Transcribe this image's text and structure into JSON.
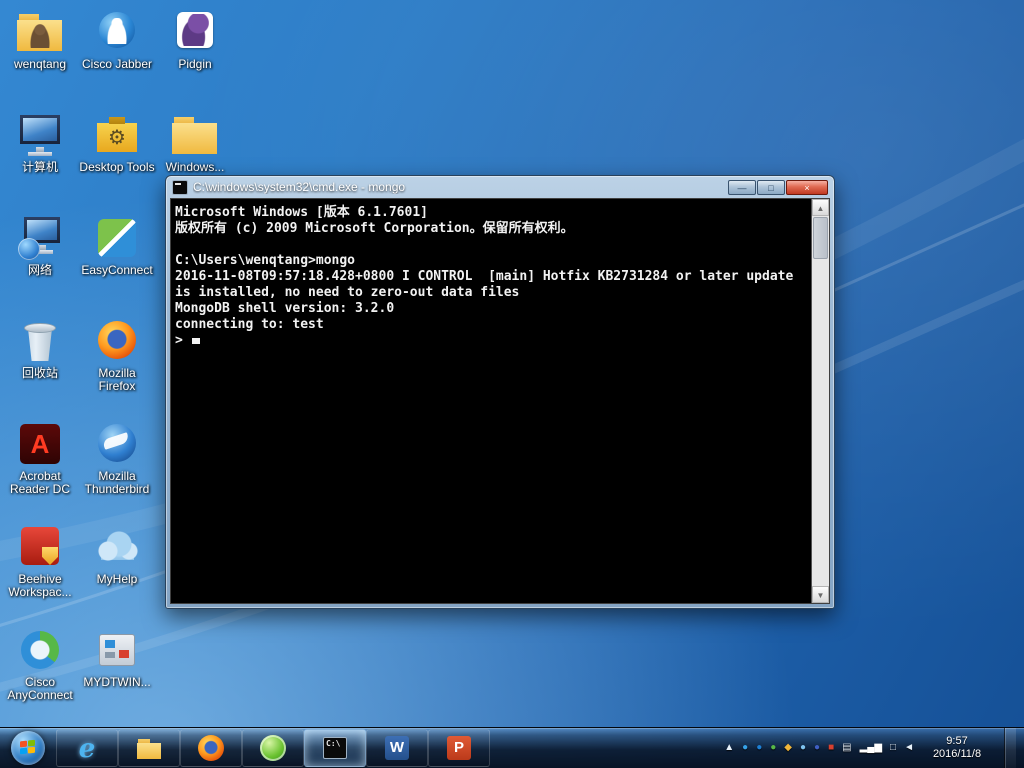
{
  "desktop": {
    "icons": [
      {
        "label": "wenqtang",
        "type": "user-folder",
        "col": 0,
        "row": 0
      },
      {
        "label": "计算机",
        "type": "computer",
        "col": 0,
        "row": 1
      },
      {
        "label": "网络",
        "type": "network",
        "col": 0,
        "row": 2
      },
      {
        "label": "回收站",
        "type": "recycle-bin",
        "col": 0,
        "row": 3
      },
      {
        "label": "Acrobat Reader DC",
        "type": "acrobat",
        "col": 0,
        "row": 4
      },
      {
        "label": "Beehive Workspac...",
        "type": "beehive",
        "col": 0,
        "row": 5
      },
      {
        "label": "Cisco AnyConnect",
        "type": "anyconnect",
        "col": 0,
        "row": 6
      },
      {
        "label": "Cisco Jabber",
        "type": "jabber",
        "col": 1,
        "row": 0
      },
      {
        "label": "Desktop Tools",
        "type": "toolbox",
        "col": 1,
        "row": 1
      },
      {
        "label": "EasyConnect",
        "type": "easyconnect",
        "col": 1,
        "row": 2
      },
      {
        "label": "Mozilla Firefox",
        "type": "firefox",
        "col": 1,
        "row": 3
      },
      {
        "label": "Mozilla Thunderbird",
        "type": "thunderbird",
        "col": 1,
        "row": 4
      },
      {
        "label": "MyHelp",
        "type": "myhelp",
        "col": 1,
        "row": 5
      },
      {
        "label": "MYDTWIN...",
        "type": "installer",
        "col": 1,
        "row": 6
      },
      {
        "label": "Pidgin",
        "type": "pidgin",
        "col": 2,
        "row": 0
      },
      {
        "label": "Windows...",
        "type": "folder",
        "col": 2,
        "row": 1
      }
    ]
  },
  "window": {
    "title": "C:\\windows\\system32\\cmd.exe - mongo",
    "controls": {
      "minimize": "—",
      "maximize": "□",
      "close": "×"
    },
    "scrollbar": {
      "up": "▲",
      "down": "▼"
    },
    "lines": [
      "Microsoft Windows [版本 6.1.7601]",
      "版权所有 (c) 2009 Microsoft Corporation。保留所有权利。",
      "",
      "C:\\Users\\wenqtang>mongo",
      "2016-11-08T09:57:18.428+0800 I CONTROL  [main] Hotfix KB2731284 or later update",
      "is installed, no need to zero-out data files",
      "MongoDB shell version: 3.2.0",
      "connecting to: test",
      "> "
    ]
  },
  "taskbar": {
    "buttons": [
      {
        "icon": "ie-icon",
        "active": false
      },
      {
        "icon": "explorer-icon",
        "active": false
      },
      {
        "icon": "firefox-icon",
        "active": false
      },
      {
        "icon": "browser-icon",
        "active": false
      },
      {
        "icon": "cmd-icon",
        "active": true
      },
      {
        "icon": "word-icon",
        "active": false
      },
      {
        "icon": "powerpoint-icon",
        "active": false
      }
    ],
    "tray": [
      {
        "name": "hidden-icons-chevron",
        "glyph": "▲",
        "color": "#e8f2fb"
      },
      {
        "name": "tray-blue-app-icon",
        "glyph": "●",
        "color": "#35a2e8"
      },
      {
        "name": "tray-jabber-icon",
        "glyph": "●",
        "color": "#1d7fd4"
      },
      {
        "name": "tray-green-app-icon",
        "glyph": "●",
        "color": "#57b847"
      },
      {
        "name": "tray-shield-icon",
        "glyph": "◆",
        "color": "#f0b63a"
      },
      {
        "name": "tray-cloud-icon",
        "glyph": "●",
        "color": "#7fc3ef"
      },
      {
        "name": "tray-comm-icon",
        "glyph": "●",
        "color": "#3f5fc4"
      },
      {
        "name": "tray-red-app-icon",
        "glyph": "■",
        "color": "#d8402f"
      },
      {
        "name": "tray-notes-icon",
        "glyph": "▤",
        "color": "#d8dee6"
      },
      {
        "name": "signal-strength-icon",
        "glyph": "▂▄▆",
        "color": "#ffffff"
      },
      {
        "name": "network-icon",
        "glyph": "□",
        "color": "#dfe9f2"
      },
      {
        "name": "volume-icon",
        "glyph": "◄",
        "color": "#e8f2fb"
      }
    ],
    "clock": {
      "time": "9:57",
      "date": "2016/11/8"
    }
  }
}
